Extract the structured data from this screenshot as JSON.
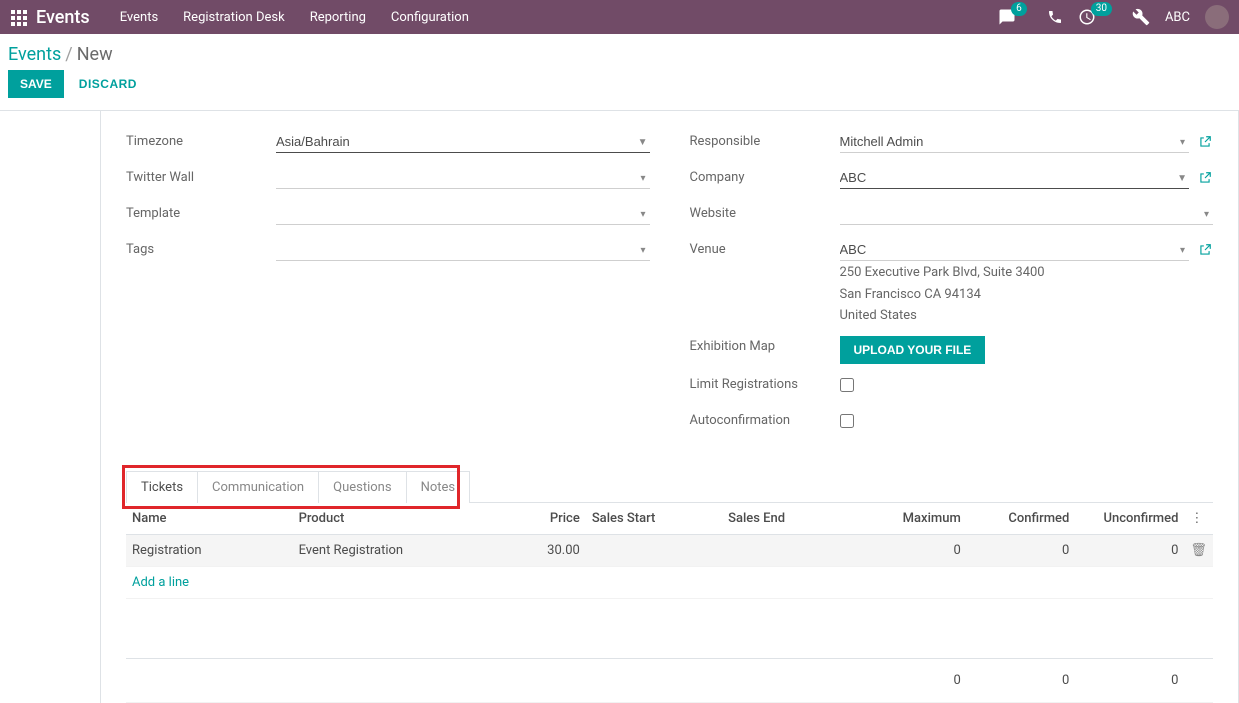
{
  "header": {
    "brand": "Events",
    "menu": [
      "Events",
      "Registration Desk",
      "Reporting",
      "Configuration"
    ],
    "chat_badge": "6",
    "activity_badge": "30",
    "user": "ABC"
  },
  "breadcrumb": {
    "root": "Events",
    "current": "New"
  },
  "actions": {
    "save": "SAVE",
    "discard": "DISCARD"
  },
  "form": {
    "left": {
      "timezone_label": "Timezone",
      "timezone_value": "Asia/Bahrain",
      "twitter_label": "Twitter Wall",
      "twitter_value": "",
      "template_label": "Template",
      "template_value": "",
      "tags_label": "Tags",
      "tags_value": ""
    },
    "right": {
      "responsible_label": "Responsible",
      "responsible_value": "Mitchell Admin",
      "company_label": "Company",
      "company_value": "ABC",
      "website_label": "Website",
      "website_value": "",
      "venue_label": "Venue",
      "venue_value": "ABC",
      "venue_addr1": "250 Executive Park Blvd, Suite 3400",
      "venue_addr2": "San Francisco CA 94134",
      "venue_addr3": "United States",
      "map_label": "Exhibition Map",
      "map_button": "UPLOAD YOUR FILE",
      "limit_label": "Limit Registrations",
      "autoconf_label": "Autoconfirmation"
    }
  },
  "tabs": [
    "Tickets",
    "Communication",
    "Questions",
    "Notes"
  ],
  "tickets": {
    "columns": {
      "name": "Name",
      "product": "Product",
      "price": "Price",
      "start": "Sales Start",
      "end": "Sales End",
      "max": "Maximum",
      "confirmed": "Confirmed",
      "unconfirmed": "Unconfirmed"
    },
    "row": {
      "name": "Registration",
      "product": "Event Registration",
      "price": "30.00",
      "start": "",
      "end": "",
      "max": "0",
      "confirmed": "0",
      "unconfirmed": "0"
    },
    "add_line": "Add a line",
    "totals": {
      "max": "0",
      "confirmed": "0",
      "unconfirmed": "0"
    }
  }
}
